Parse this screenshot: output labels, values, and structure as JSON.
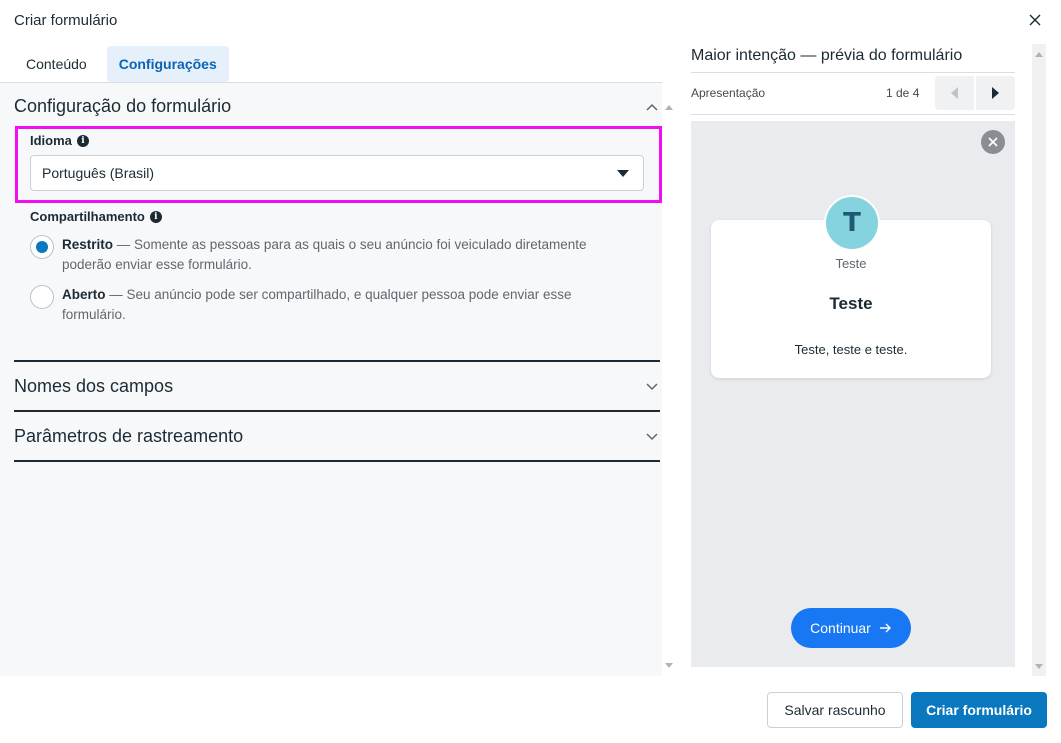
{
  "dialog": {
    "title": "Criar formulário"
  },
  "tabs": [
    {
      "label": "Conteúdo",
      "active": false
    },
    {
      "label": "Configurações",
      "active": true
    }
  ],
  "form_config": {
    "section_title": "Configuração do formulário",
    "language": {
      "label": "Idioma",
      "value": "Português (Brasil)"
    },
    "sharing": {
      "label": "Compartilhamento",
      "options": [
        {
          "title": "Restrito",
          "description": " — Somente as pessoas para as quais o seu anúncio foi veiculado diretamente poderão enviar esse formulário.",
          "checked": true
        },
        {
          "title": "Aberto",
          "description": " — Seu anúncio pode ser compartilhado, e qualquer pessoa pode enviar esse formulário.",
          "checked": false
        }
      ]
    }
  },
  "sections": [
    {
      "title": "Nomes dos campos"
    },
    {
      "title": "Parâmetros de rastreamento"
    }
  ],
  "preview": {
    "title": "Maior intenção — prévia do formulário",
    "step": "Apresentação",
    "page": "1 de 4",
    "avatar_letter": "T",
    "card_subtitle": "Teste",
    "card_title": "Teste",
    "card_description": "Teste, teste e teste.",
    "continue_label": "Continuar"
  },
  "footer": {
    "save_draft": "Salvar rascunho",
    "create": "Criar formulário"
  },
  "colors": {
    "primary": "#0a78be",
    "highlight": "#f00ff0",
    "continue": "#1877f2"
  }
}
